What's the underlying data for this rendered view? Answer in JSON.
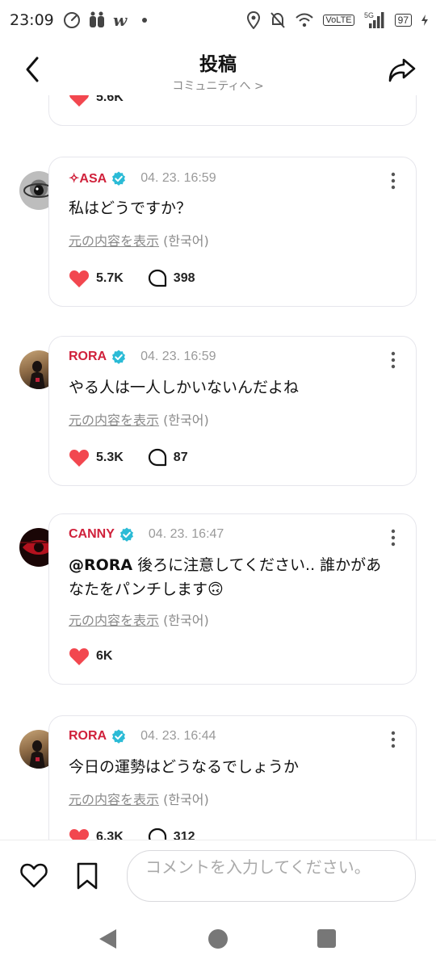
{
  "status_bar": {
    "time": "23:09",
    "network": "VoLTE",
    "signal_label": "5G",
    "battery": "97"
  },
  "header": {
    "title": "投稿",
    "subtitle": "コミュニティへ >"
  },
  "colors": {
    "username": "#d0213b",
    "heart": "#f2474f",
    "verified": "#2bbbd6",
    "muted": "#8a8a8a"
  },
  "partial_card": {
    "likes": "5.6K"
  },
  "comments": [
    {
      "user": "✧ASA",
      "verified": true,
      "timestamp": "04. 23. 16:59",
      "text": "私はどうですか？",
      "translate_link": "元の内容を表示",
      "translate_lang": "(한국어)",
      "likes": "5.7K",
      "replies": "398"
    },
    {
      "user": "RORA",
      "verified": true,
      "timestamp": "04. 23. 16:59",
      "text": "やる人は一人しかいないんだよね",
      "translate_link": "元の内容を表示",
      "translate_lang": "(한국어)",
      "likes": "5.3K",
      "replies": "87"
    },
    {
      "user": "CANNY",
      "verified": true,
      "timestamp": "04. 23. 16:47",
      "mention": "@RORA",
      "text": " 後ろに注意してください.. 誰かがあなたをパンチします🙃",
      "translate_link": "元の内容を表示",
      "translate_lang": "(한국어)",
      "likes": "6K"
    },
    {
      "user": "RORA",
      "verified": true,
      "timestamp": "04. 23. 16:44",
      "text": "今日の運勢はどうなるでしょうか",
      "translate_link": "元の内容を表示",
      "translate_lang": "(한국어)",
      "likes": "6.3K",
      "replies": "312"
    }
  ],
  "input_bar": {
    "placeholder": "コメントを入力してください。"
  },
  "icons": {
    "back": "chevron-left-icon",
    "share": "share-arrow-icon",
    "more": "more-vertical-icon",
    "like": "heart-icon",
    "reply": "speech-bubble-icon",
    "bookmark": "bookmark-icon"
  }
}
